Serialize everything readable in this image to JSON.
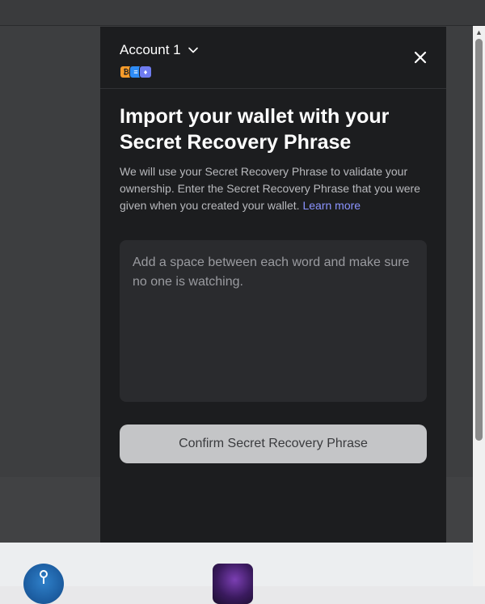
{
  "header": {
    "account_name": "Account 1",
    "badges": [
      "₿",
      "≡",
      "♦"
    ],
    "close_label": "×"
  },
  "body": {
    "title": "Import your wallet with your Secret Recovery Phrase",
    "description": "We will use your Secret Recovery Phrase to validate your ownership. Enter the Secret Recovery Phrase that you were given when you created your wallet.",
    "learn_more": "Learn more",
    "phrase_placeholder": "Add a space between each word and make sure no one is watching.",
    "phrase_value": "",
    "confirm_label": "Confirm Secret Recovery Phrase"
  },
  "colors": {
    "modal_bg": "#1c1d1f",
    "accent_link": "#8b94ff",
    "button_disabled_bg": "#c4c5c7"
  },
  "icons": {
    "account_menu": "chevron-down-icon",
    "close": "close-icon",
    "background_app_1": "map-pin-icon",
    "background_app_2": "nft-art-icon"
  }
}
